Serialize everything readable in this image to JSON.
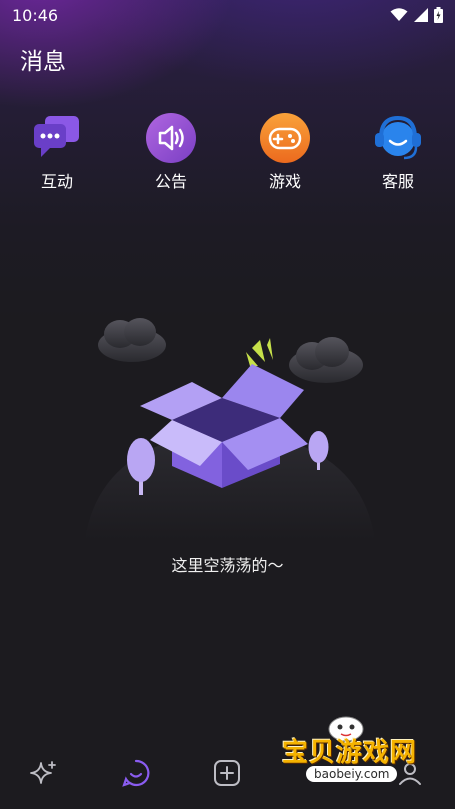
{
  "status_bar": {
    "time": "10:46"
  },
  "header": {
    "title": "消息"
  },
  "quick_actions": [
    {
      "label": "互动",
      "icon": "chat-bubble-icon",
      "color": "#7b4dd6"
    },
    {
      "label": "公告",
      "icon": "speaker-icon",
      "color": "#9a4fd0"
    },
    {
      "label": "游戏",
      "icon": "gamepad-icon",
      "color": "#f08a2a"
    },
    {
      "label": "客服",
      "icon": "headset-icon",
      "color": "#2a7be0"
    }
  ],
  "empty_state": {
    "text": "这里空荡荡的～",
    "icon": "open-box-icon"
  },
  "bottom_nav": [
    {
      "name": "discover",
      "icon": "sparkle-icon",
      "active": false
    },
    {
      "name": "messages",
      "icon": "message-smile-icon",
      "active": true
    },
    {
      "name": "publish",
      "icon": "plus-square-icon",
      "active": false
    },
    {
      "name": "profile",
      "icon": "profile-icon",
      "active": false
    }
  ],
  "watermark": {
    "text": "宝贝游戏网",
    "url": "baobeiy.com"
  },
  "colors": {
    "accent": "#8a5cf0",
    "background": "#1c1b1f"
  }
}
